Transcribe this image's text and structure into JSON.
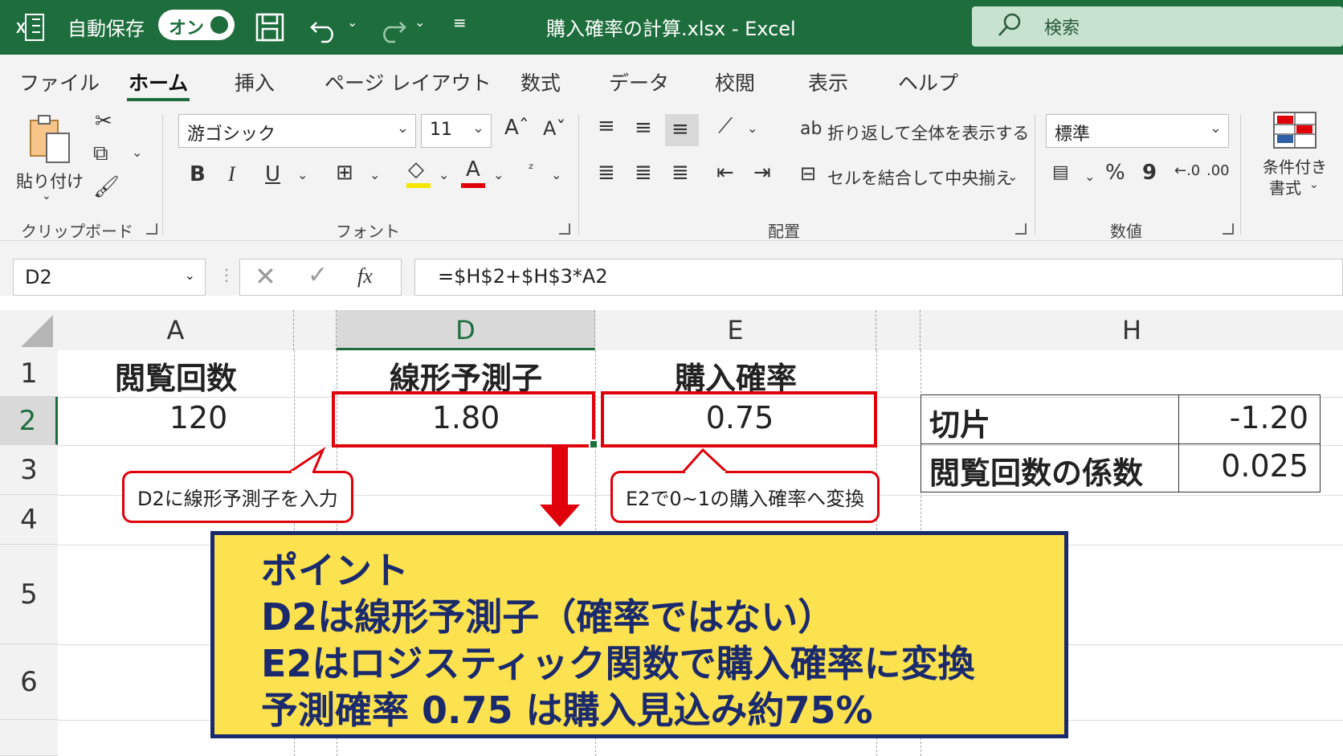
{
  "titlebar": {
    "autosave_label": "自動保存",
    "toggle_state": "オン",
    "document_title": "購入確率の計算.xlsx  -  Excel",
    "search_placeholder": "検索"
  },
  "tabs": [
    {
      "label": "ファイル"
    },
    {
      "label": "ホーム"
    },
    {
      "label": "挿入"
    },
    {
      "label": "ページ レイアウト"
    },
    {
      "label": "数式"
    },
    {
      "label": "データ"
    },
    {
      "label": "校閲"
    },
    {
      "label": "表示"
    },
    {
      "label": "ヘルプ"
    }
  ],
  "ribbon": {
    "clipboard": {
      "paste_label": "貼り付け",
      "group_label": "クリップボード"
    },
    "font": {
      "font_name": "游ゴシック",
      "font_size": "11",
      "bold": "B",
      "italic": "I",
      "underline": "U",
      "group_label": "フォント"
    },
    "alignment": {
      "wrap_text": "折り返して全体を表示する",
      "merge_center": "セルを結合して中央揃え",
      "group_label": "配置"
    },
    "number": {
      "format": "標準",
      "percent": "%",
      "comma": "9",
      "group_label": "数値"
    },
    "styles": {
      "conditional_format_line1": "条件付き",
      "conditional_format_line2": "書式"
    }
  },
  "formula_bar": {
    "name_box": "D2",
    "fx": "fx",
    "formula": "=$H$2+$H$3*A2"
  },
  "columns": [
    "A",
    "D",
    "E",
    "H"
  ],
  "rows": [
    "1",
    "2",
    "3",
    "4",
    "5",
    "6"
  ],
  "cells": {
    "A1": "閲覧回数",
    "D1": "線形予測子",
    "E1": "購入確率",
    "A2": "120",
    "D2": "1.80",
    "E2": "0.75"
  },
  "h_table": [
    {
      "label": "切片",
      "value": "-1.20"
    },
    {
      "label": "閲覧回数の係数",
      "value": "0.025"
    }
  ],
  "callouts": {
    "d2": "D2に線形予測子を入力",
    "e2": "E2で0~1の購入確率へ変換"
  },
  "point_box": {
    "title": "ポイント",
    "line1": "D2は線形予測子（確率ではない）",
    "line2": "E2はロジスティック関数で購入確率に変換",
    "line3": "予測確率 0.75 は購入見込み約75%"
  },
  "colors": {
    "excel_green": "#1e6e3d",
    "highlight_red": "#e0000a",
    "point_yellow": "#fde24f",
    "point_navy": "#1a2a6c"
  }
}
